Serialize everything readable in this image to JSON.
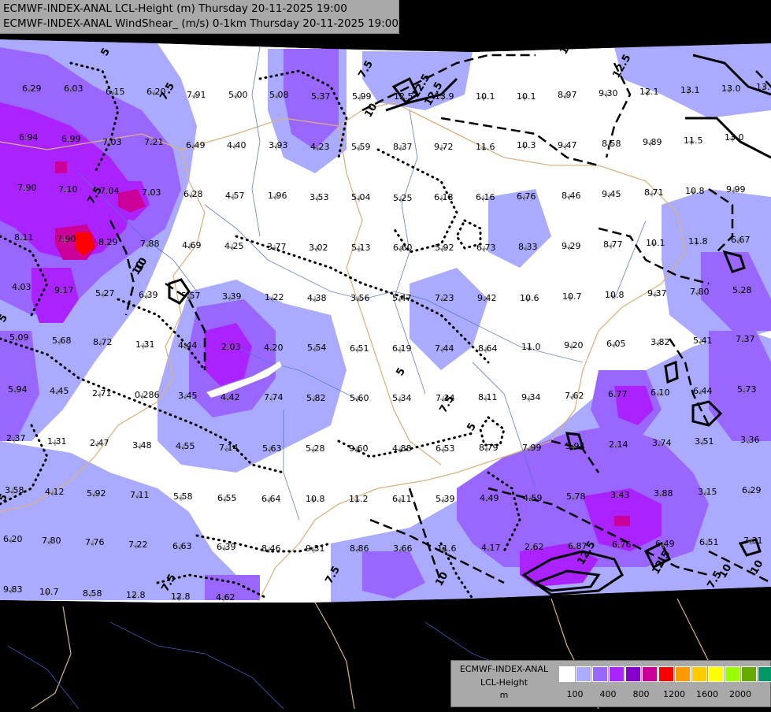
{
  "header": {
    "line1": "ECMWF-INDEX-ANAL LCL-Height (m) Thursday 20-11-2025 19:00",
    "line2": "ECMWF-INDEX-ANAL WindShear_ (m/s) 0-1km Thursday 20-11-2025 19:00"
  },
  "legend": {
    "title1": "ECMWF-INDEX-ANAL",
    "title2": "LCL-Height",
    "title3": "m",
    "colors": [
      "#ffffff",
      "#aaaaff",
      "#9966ff",
      "#aa22ff",
      "#8800cc",
      "#cc0099",
      "#ff0000",
      "#ff9900",
      "#ffcc00",
      "#ffff00",
      "#99ff00",
      "#66aa00",
      "#009966",
      "#00aaff"
    ],
    "ticks": [
      "100",
      "400",
      "800",
      "1200",
      "1600",
      "2000"
    ]
  },
  "shear_values": [
    "6.29",
    "6.03",
    "6.15",
    "6.20",
    "7.91",
    "5.00",
    "5.08",
    "5.37",
    "5.99",
    "12.5",
    "13.9",
    "10.1",
    "10.1",
    "8.97",
    "9.30",
    "12.1",
    "13.1",
    "13.0",
    "13.6",
    "6.94",
    "6.99",
    "7.03",
    "7.21",
    "6.49",
    "4.40",
    "3.93",
    "4.23",
    "5.59",
    "8.37",
    "9.72",
    "11.6",
    "10.3",
    "9.47",
    "8.58",
    "9.89",
    "11.5",
    "13.0",
    "7.90",
    "7.10",
    "7.04",
    "7.03",
    "6.28",
    "4.57",
    "1.96",
    "3.53",
    "5.04",
    "5.25",
    "6.18",
    "6.16",
    "6.76",
    "8.46",
    "9.45",
    "8.71",
    "10.8",
    "9.99",
    "8.11",
    "7.90",
    "8.29",
    "7.88",
    "4.69",
    "4.25",
    "3.77",
    "3.02",
    "5.13",
    "6.60",
    "5.92",
    "6.73",
    "8.33",
    "9.29",
    "8.77",
    "10.1",
    "11.8",
    "6.67",
    "4.03",
    "9.17",
    "5.27",
    "6.39",
    "5.57",
    "3.39",
    "1.22",
    "4.38",
    "3.56",
    "5.47",
    "7.23",
    "9.42",
    "10.6",
    "10.7",
    "10.8",
    "9.37",
    "7.80",
    "5.28",
    "5.09",
    "5.68",
    "8.72",
    "1.31",
    "4.44",
    "2.03",
    "4.20",
    "5.54",
    "6.51",
    "6.19",
    "7.44",
    "8.64",
    "11.0",
    "9.20",
    "6.05",
    "3.82",
    "5.41",
    "7.37",
    "5.94",
    "4.45",
    "2.71",
    "0.286",
    "3.45",
    "4.42",
    "7.74",
    "5.82",
    "5.60",
    "5.34",
    "7.34",
    "8.11",
    "9.34",
    "7.62",
    "6.77",
    "6.10",
    "6.44",
    "5.73",
    "2.37",
    "1.31",
    "2.47",
    "3.48",
    "4.55",
    "7.14",
    "5.63",
    "5.28",
    "9.60",
    "4.88",
    "6.53",
    "8.79",
    "7.99",
    "5.94",
    "2.14",
    "3.74",
    "3.51",
    "3.36",
    "3.58",
    "4.12",
    "5.92",
    "7.11",
    "5.58",
    "6.55",
    "6.64",
    "10.8",
    "11.2",
    "6.11",
    "5.39",
    "4.49",
    "4.59",
    "5.78",
    "3.43",
    "3.88",
    "3.15",
    "6.29",
    "6.20",
    "7.80",
    "7.76",
    "7.22",
    "6.63",
    "6.39",
    "8.46",
    "9.31",
    "8.86",
    "3.66",
    "11.6",
    "4.17",
    "2.62",
    "6.87",
    "6.76",
    "6.49",
    "6.51",
    "7.31",
    "9.83",
    "10.7",
    "8.58",
    "12.8",
    "12.8",
    "4.62"
  ],
  "contour_labels": [
    "5",
    "5",
    "7.5",
    "7.5",
    "10",
    "10",
    "12.5",
    "12.5",
    "10",
    "12.5",
    "7.5",
    "10",
    "5",
    "7.5",
    "5",
    "5",
    "7.5",
    "7.5",
    "10",
    "12.5",
    "10",
    "12.5",
    "7.5",
    "10"
  ]
}
